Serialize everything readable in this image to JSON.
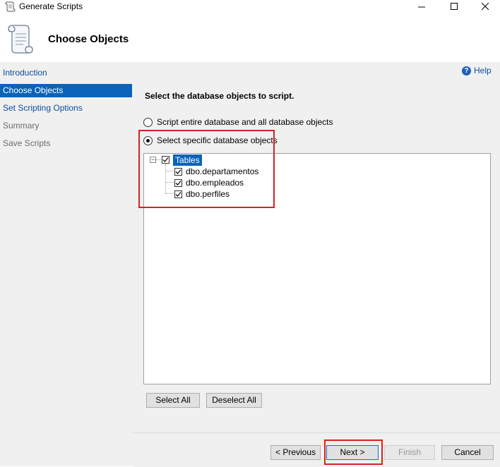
{
  "window": {
    "title": "Generate Scripts",
    "controls": {
      "minimize": "—",
      "maximize": "☐",
      "close": "✕"
    }
  },
  "header": {
    "title": "Choose Objects",
    "icon": "scroll-icon"
  },
  "sidebar": {
    "items": [
      {
        "label": "Introduction",
        "state": "link"
      },
      {
        "label": "Choose Objects",
        "state": "selected"
      },
      {
        "label": "Set Scripting Options",
        "state": "link"
      },
      {
        "label": "Summary",
        "state": "disabled"
      },
      {
        "label": "Save Scripts",
        "state": "disabled"
      }
    ]
  },
  "main": {
    "help_label": "Help",
    "help_icon_glyph": "?",
    "heading": "Select the database objects to script.",
    "options": [
      {
        "label": "Script entire database and all database objects",
        "checked": false
      },
      {
        "label": "Select specific database objects",
        "checked": true
      }
    ],
    "tree": {
      "expander": "−",
      "root": {
        "label": "Tables",
        "checked": true
      },
      "items": [
        {
          "label": "dbo.departamentos",
          "checked": true
        },
        {
          "label": "dbo.empleados",
          "checked": true
        },
        {
          "label": "dbo.perfiles",
          "checked": true
        }
      ]
    },
    "select_all_label": "Select All",
    "deselect_all_label": "Deselect All"
  },
  "footer": {
    "previous_label": "< Previous",
    "next_label": "Next >",
    "finish_label": "Finish",
    "cancel_label": "Cancel"
  },
  "colors": {
    "accent": "#0a63b8",
    "link": "#0b4ea2",
    "highlight": "#d91f26",
    "panel": "#f0f0f0"
  }
}
